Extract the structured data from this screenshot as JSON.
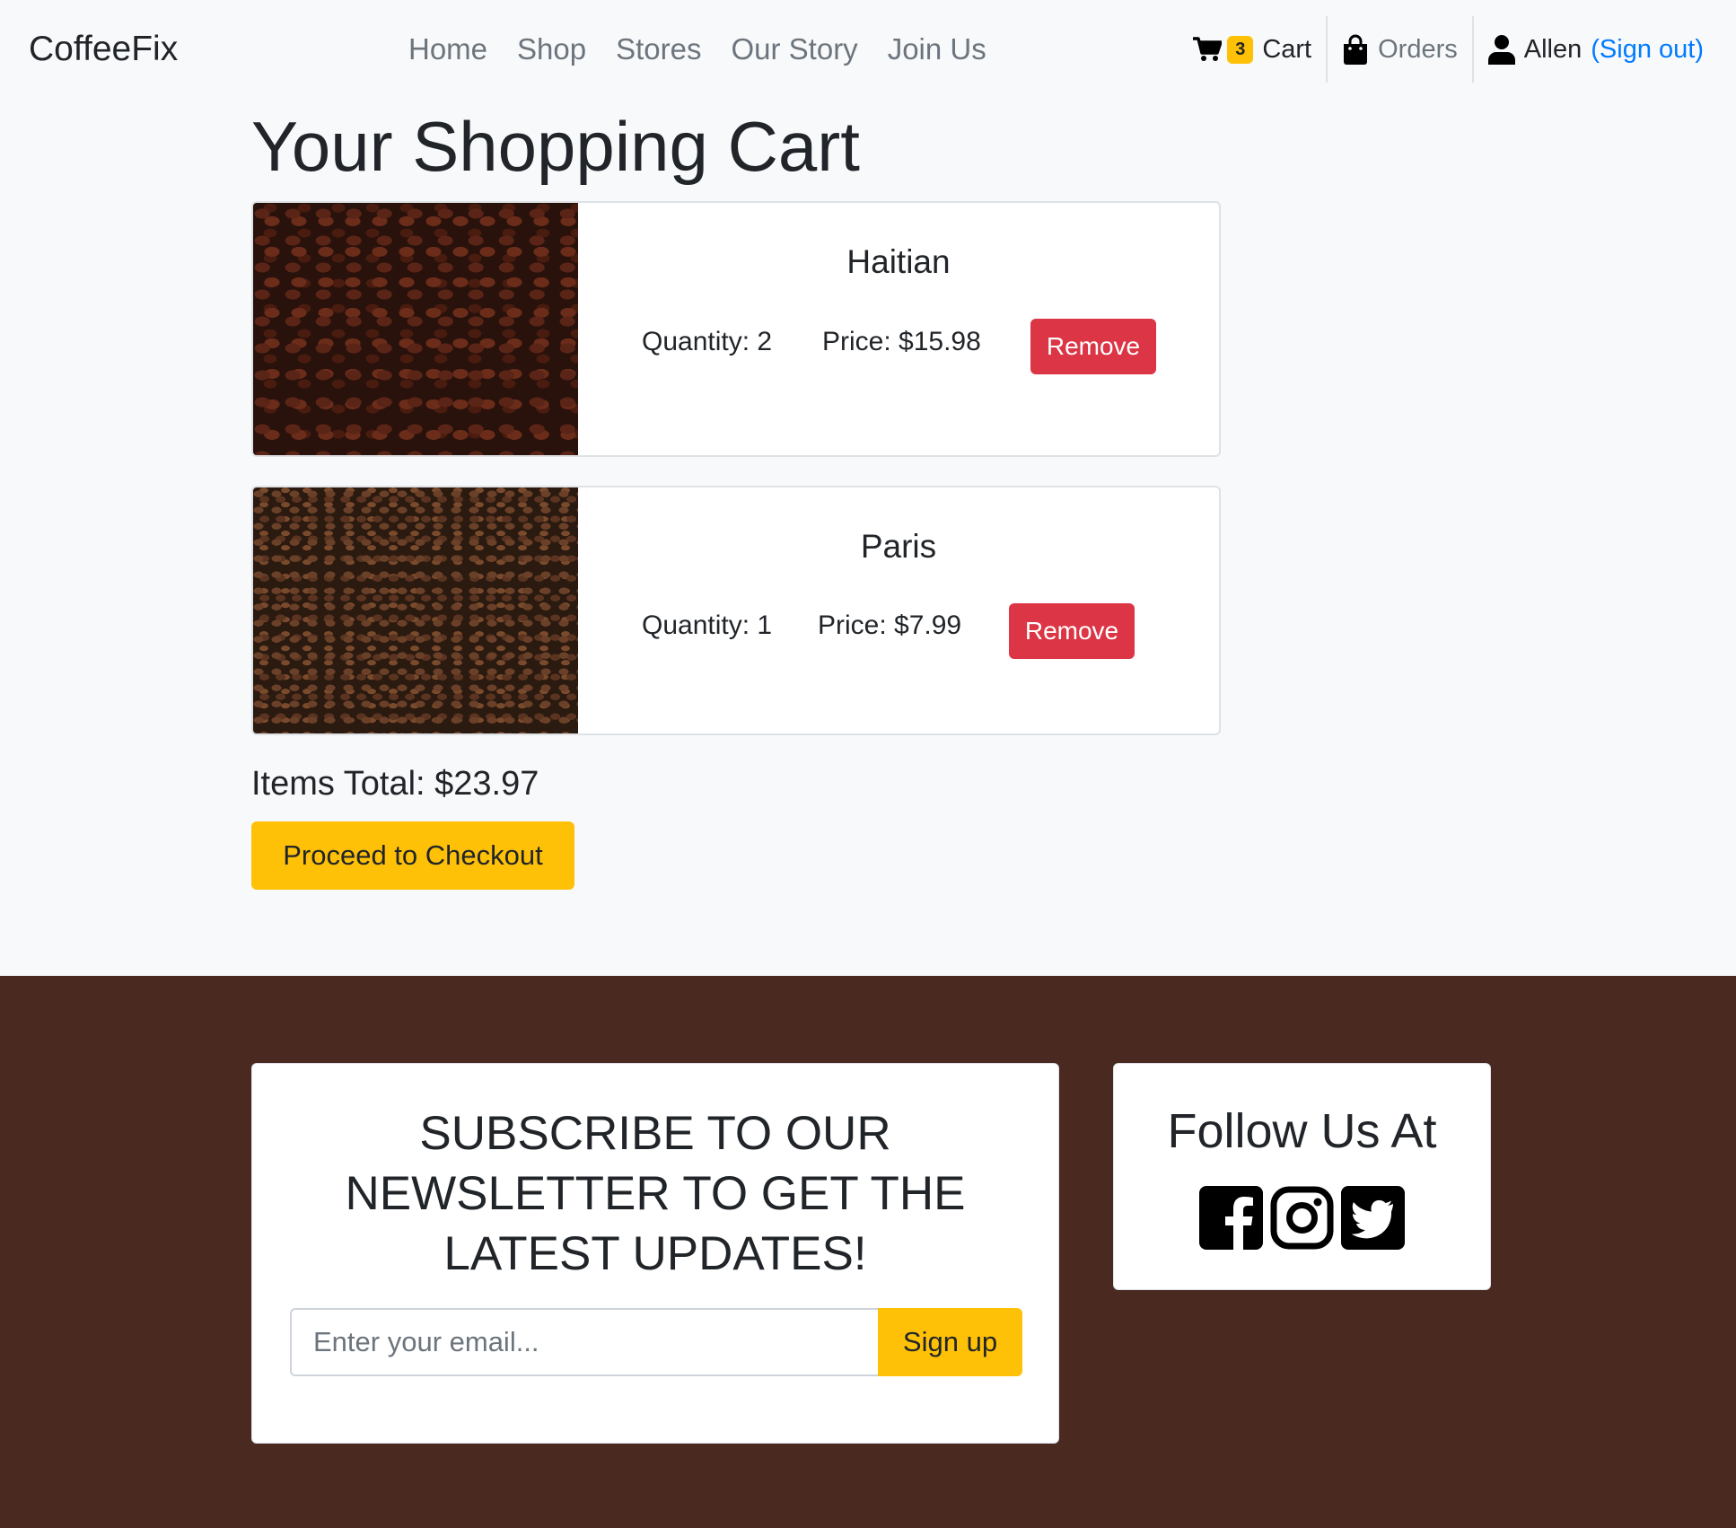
{
  "nav": {
    "brand": "CoffeeFix",
    "links": [
      "Home",
      "Shop",
      "Stores",
      "Our Story",
      "Join Us"
    ],
    "cart_count": "3",
    "cart_label": "Cart",
    "orders_label": "Orders",
    "user_name": "Allen",
    "signout_label": "(Sign out)",
    "icons": [
      "cart-icon",
      "shopping-bag-icon",
      "user-icon"
    ]
  },
  "page": {
    "title": "Your Shopping Cart"
  },
  "cart": {
    "items": [
      {
        "name": "Haitian",
        "quantity": "Quantity: 2",
        "price": "Price: $15.98",
        "remove_label": "Remove",
        "image": "coffee-beans-dark"
      },
      {
        "name": "Paris",
        "quantity": "Quantity: 1",
        "price": "Price: $7.99",
        "remove_label": "Remove",
        "image": "coffee-beans-medium"
      }
    ],
    "total": "Items Total: $23.97",
    "checkout_label": "Proceed to Checkout"
  },
  "footer": {
    "newsletter_title": "SUBSCRIBE TO OUR NEWSLETTER TO GET THE LATEST UPDATES!",
    "email_placeholder": "Enter your email...",
    "signup_label": "Sign up",
    "follow_title": "Follow Us At",
    "social_icons": [
      "facebook-icon",
      "instagram-icon",
      "twitter-icon"
    ]
  },
  "colors": {
    "accent_yellow": "#ffc107",
    "danger_red": "#dc3545",
    "link_blue": "#007bff",
    "footer_brown": "#4a2a20",
    "page_bg": "#f8f9fa"
  }
}
